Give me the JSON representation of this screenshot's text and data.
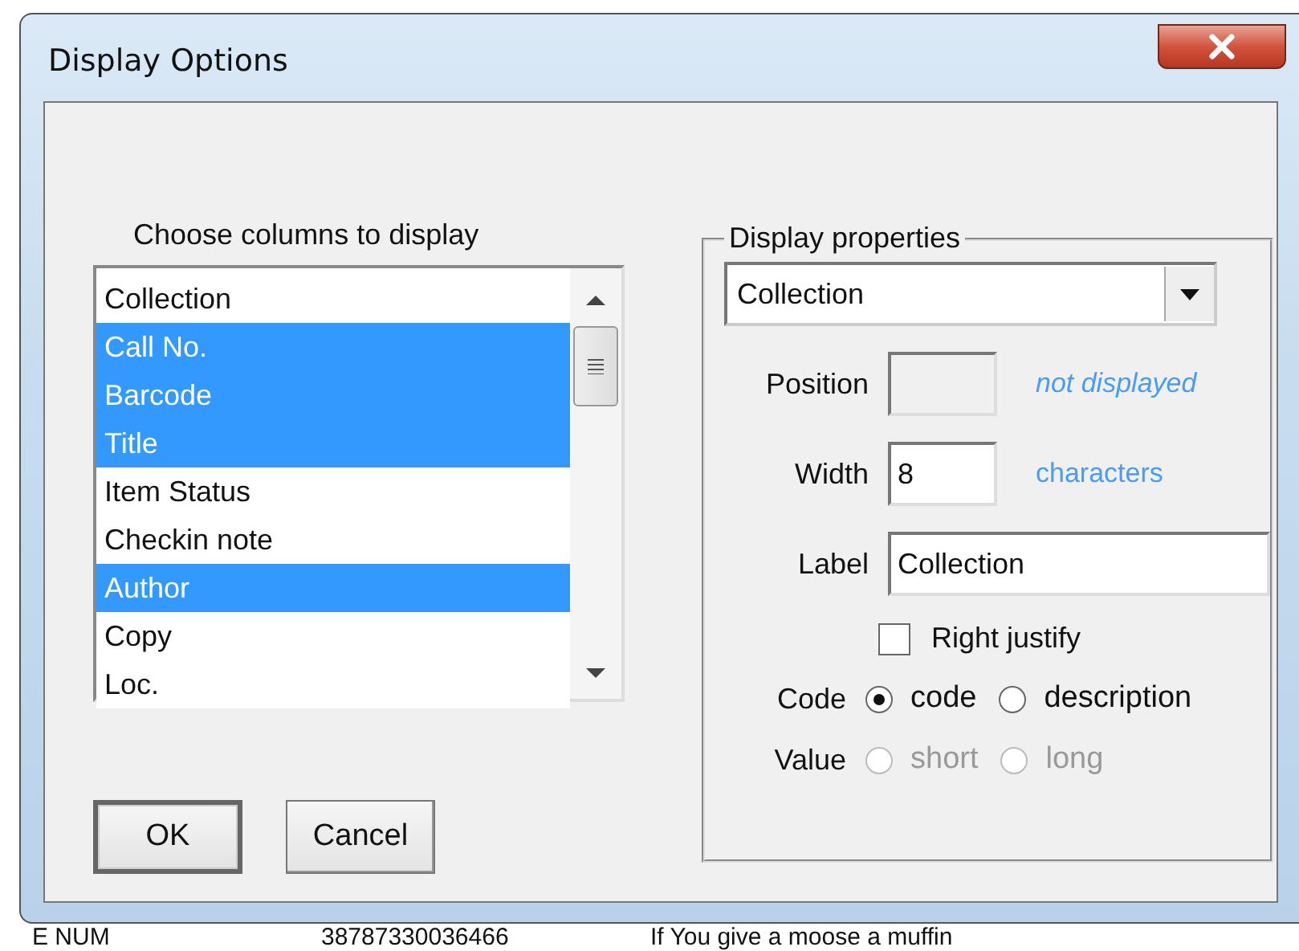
{
  "window": {
    "title": "Display Options"
  },
  "columns_list": {
    "heading": "Choose columns to display",
    "items": [
      {
        "label": "Collection",
        "selected": false
      },
      {
        "label": "Call No.",
        "selected": true
      },
      {
        "label": "Barcode",
        "selected": true
      },
      {
        "label": "Title",
        "selected": true
      },
      {
        "label": "Item Status",
        "selected": false
      },
      {
        "label": "Checkin note",
        "selected": false
      },
      {
        "label": "Author",
        "selected": true
      },
      {
        "label": "Copy",
        "selected": false
      },
      {
        "label": "Loc.",
        "selected": false
      }
    ]
  },
  "buttons": [
    {
      "label": "OK",
      "default": true
    },
    {
      "label": "Cancel",
      "default": false
    }
  ],
  "properties": {
    "legend": "Display properties",
    "dropdown": {
      "value": "Collection"
    },
    "position": {
      "label": "Position",
      "disabled": true,
      "note": "not displayed"
    },
    "width": {
      "label": "Width",
      "value": "8",
      "note": "characters"
    },
    "label_field": {
      "label": "Label",
      "value": "Collection"
    },
    "right_justify": {
      "label": "Right justify",
      "checked": false
    },
    "radio_groups": [
      {
        "label": "Code",
        "disabled": false,
        "options": [
          {
            "label": "code",
            "selected": true
          },
          {
            "label": "description",
            "selected": false
          }
        ]
      },
      {
        "label": "Value",
        "disabled": true,
        "options": [
          {
            "label": "short",
            "selected": false
          },
          {
            "label": "long",
            "selected": false
          }
        ]
      }
    ]
  },
  "background_rows": [
    {
      "column_1": "E NUM",
      "column_2": "38787330036466",
      "column_3": "If You give a moose a muffin"
    }
  ]
}
